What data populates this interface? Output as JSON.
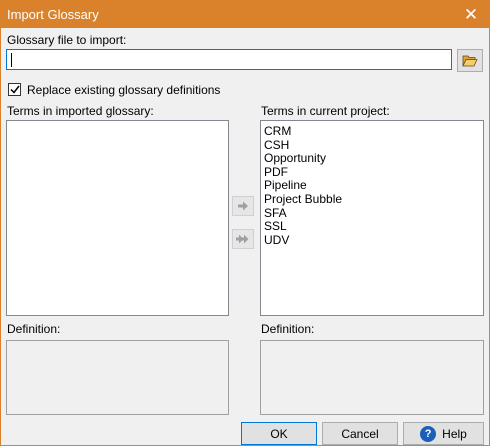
{
  "dialog": {
    "title": "Import Glossary",
    "close_glyph": "✕"
  },
  "file_import": {
    "label": "Glossary file to import:",
    "value": "",
    "browse_icon": "open-folder-icon"
  },
  "replace_option": {
    "label": "Replace existing glossary definitions",
    "checked": true
  },
  "imported": {
    "label": "Terms in imported glossary:",
    "items": [],
    "definition_label": "Definition:"
  },
  "current": {
    "label": "Terms in current project:",
    "items": [
      "CRM",
      "CSH",
      "Opportunity",
      "PDF",
      "Pipeline",
      "Project Bubble",
      "SFA",
      "SSL",
      "UDV"
    ],
    "definition_label": "Definition:"
  },
  "buttons": {
    "ok": "OK",
    "cancel": "Cancel",
    "help": "Help",
    "help_glyph": "?"
  },
  "colors": {
    "titlebar": "#d9822b",
    "focus": "#0078d7"
  }
}
